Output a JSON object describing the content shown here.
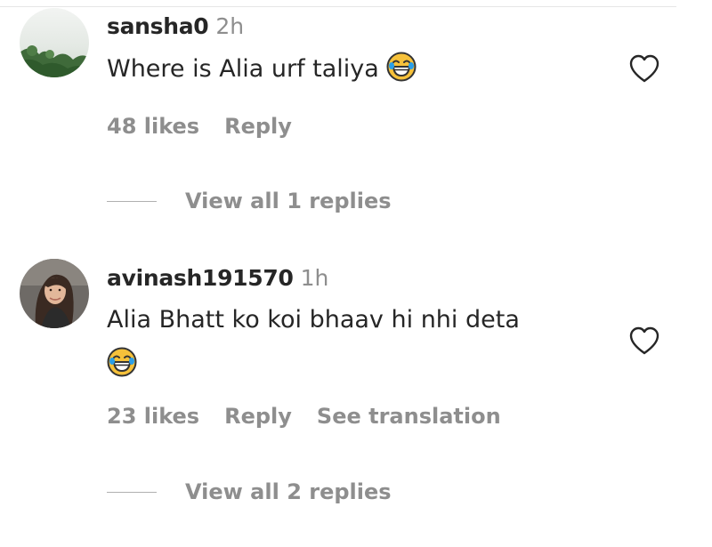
{
  "comments": [
    {
      "username": "sansha0",
      "time": "2h",
      "text": "Where is Alia urf taliya",
      "emoji": "face-with-tears-of-joy-emoji",
      "likes": "48 likes",
      "reply": "Reply",
      "view_replies": "View all 1 replies",
      "like_icon": "heart-outline-icon"
    },
    {
      "username": "avinash191570",
      "time": "1h",
      "text": "Alia Bhatt ko koi bhaav hi nhi deta",
      "emoji": "face-with-tears-of-joy-emoji",
      "likes": "23 likes",
      "reply": "Reply",
      "translate": "See translation",
      "view_replies": "View all 2 replies",
      "like_icon": "heart-outline-icon"
    }
  ],
  "colors": {
    "primary_text": "#262626",
    "secondary_text": "#8e8e8e",
    "divider": "#e6e6e6"
  }
}
